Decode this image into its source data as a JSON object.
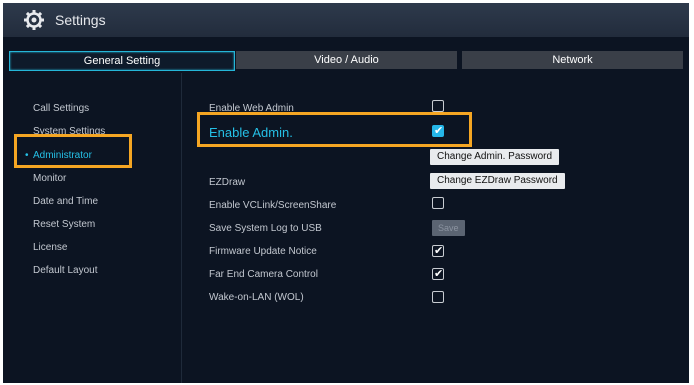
{
  "window": {
    "title": "Settings",
    "icon": "gear-icon"
  },
  "tabs": [
    {
      "label": "General Setting",
      "active": true
    },
    {
      "label": "Video / Audio",
      "active": false
    },
    {
      "label": "Network",
      "active": false
    }
  ],
  "sidebar": {
    "items": [
      {
        "label": "Call Settings",
        "active": false
      },
      {
        "label": "System Settings",
        "active": false
      },
      {
        "label": "Administrator",
        "active": true
      },
      {
        "label": "Monitor",
        "active": false
      },
      {
        "label": "Date and Time",
        "active": false
      },
      {
        "label": "Reset System",
        "active": false
      },
      {
        "label": "License",
        "active": false
      },
      {
        "label": "Default Layout",
        "active": false
      }
    ]
  },
  "settings": {
    "enable_web_admin": {
      "label": "Enable Web Admin",
      "checked": false
    },
    "enable_admin": {
      "label": "Enable Admin.",
      "checked": true
    },
    "change_admin_password": {
      "label": "Change Admin. Password"
    },
    "ezdraw": {
      "label": "EZDraw",
      "button": "Change EZDraw Password"
    },
    "enable_vclink": {
      "label": "Enable VCLink/ScreenShare",
      "checked": false
    },
    "save_log": {
      "label": "Save System Log to USB",
      "button": "Save"
    },
    "firmware_notice": {
      "label": "Firmware Update Notice",
      "checked": true
    },
    "far_end_camera": {
      "label": "Far End Camera Control",
      "checked": true
    },
    "wake_on_lan": {
      "label": "Wake-on-LAN (WOL)",
      "checked": false
    }
  },
  "colors": {
    "accent": "#25c0e6",
    "highlight": "#f5a623",
    "background": "#0c1422"
  }
}
